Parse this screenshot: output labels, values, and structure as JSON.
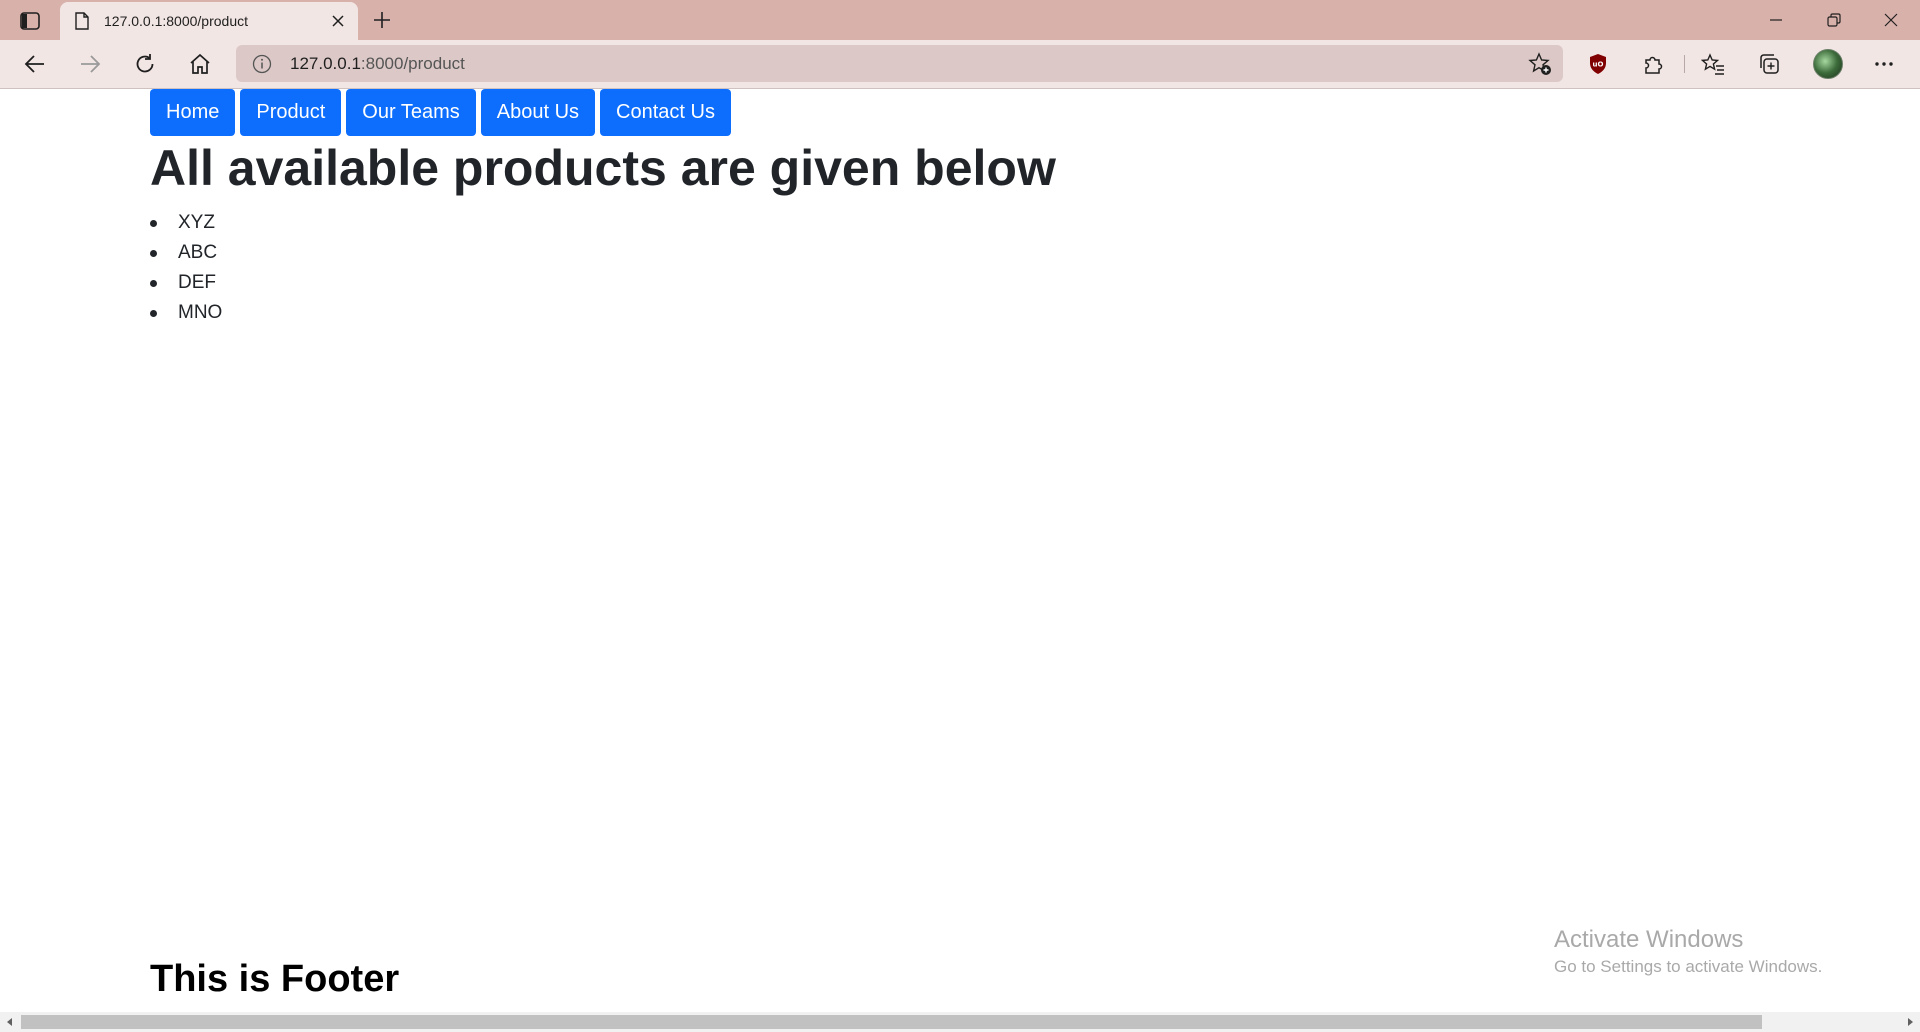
{
  "browser": {
    "tab": {
      "title": "127.0.0.1:8000/product"
    },
    "address_bar": {
      "host": "127.0.0.1",
      "path": ":8000/product"
    },
    "icons": {
      "tab_actions": "tab-actions-icon",
      "page": "page-icon",
      "tab_close": "close-icon",
      "new_tab": "plus-icon",
      "minimize": "minimize-icon",
      "restore": "restore-icon",
      "close_window": "close-icon",
      "back": "back-arrow-icon",
      "forward": "forward-arrow-icon",
      "refresh": "refresh-icon",
      "home": "home-icon",
      "site_info": "info-icon",
      "add_favorite": "star-plus-icon",
      "ublock": "ublock-shield-icon",
      "extensions": "puzzle-icon",
      "favorites": "favorites-icon",
      "collections": "collections-icon",
      "profile": "avatar",
      "more": "more-dots-icon"
    }
  },
  "page": {
    "nav": [
      {
        "label": "Home"
      },
      {
        "label": "Product"
      },
      {
        "label": "Our Teams"
      },
      {
        "label": "About Us"
      },
      {
        "label": "Contact Us"
      }
    ],
    "heading": "All available products are given below",
    "products": [
      "XYZ",
      "ABC",
      "DEF",
      "MNO"
    ],
    "footer": "This is Footer"
  },
  "watermark": {
    "title": "Activate Windows",
    "subtitle": "Go to Settings to activate Windows."
  },
  "colors": {
    "nav_button": "#0d6efd",
    "tab_strip": "#d9b1ab",
    "toolbar": "#f2e6e4"
  }
}
